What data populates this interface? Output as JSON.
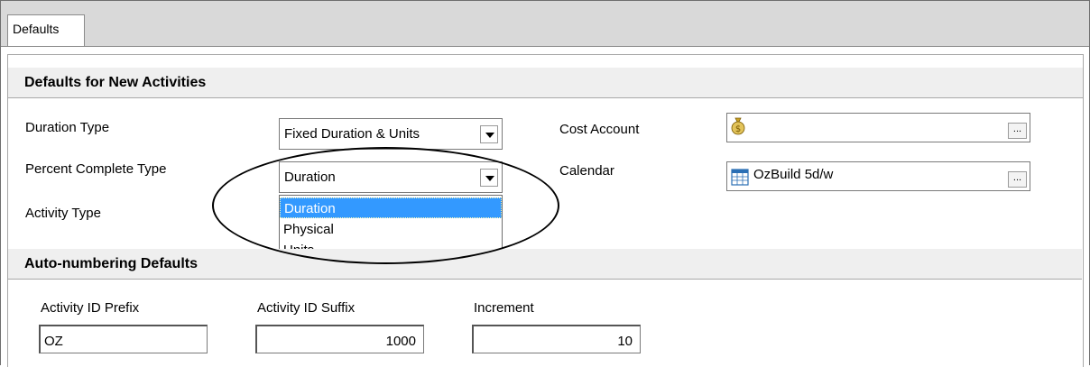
{
  "tabs": [
    {
      "label": "Defaults",
      "active": true
    }
  ],
  "sections": {
    "new_activities": {
      "title": "Defaults for New Activities"
    },
    "auto_numbering": {
      "title": "Auto-numbering Defaults"
    }
  },
  "fields": {
    "duration_type": {
      "label": "Duration Type",
      "value": "Fixed Duration & Units"
    },
    "percent_complete_type": {
      "label": "Percent Complete Type",
      "value": "Duration",
      "options": [
        "Duration",
        "Physical",
        "Units"
      ],
      "highlighted": "Duration"
    },
    "activity_type": {
      "label": "Activity Type"
    },
    "cost_account": {
      "label": "Cost Account",
      "value": "",
      "icon": "money-bag-icon"
    },
    "calendar": {
      "label": "Calendar",
      "value": "OzBuild 5d/w",
      "icon": "calendar-icon"
    },
    "browse_label": "..."
  },
  "auto_numbering": {
    "prefix": {
      "label": "Activity ID Prefix",
      "value": "OZ"
    },
    "suffix": {
      "label": "Activity ID Suffix",
      "value": "1000"
    },
    "increment": {
      "label": "Increment",
      "value": "10"
    }
  },
  "colors": {
    "selection": "#3399ff",
    "section_bg": "#efefef",
    "tabstrip_bg": "#d9d9d9"
  }
}
